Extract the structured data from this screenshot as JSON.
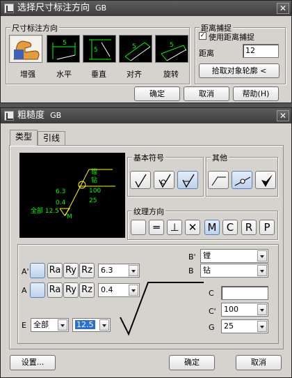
{
  "dialog1": {
    "title": "选择尺寸标注方向",
    "title_suffix": "GB",
    "group_direction": "尺寸标注方向",
    "tiles": [
      {
        "label": "增强",
        "icon": "arm-flex-icon",
        "dim": ""
      },
      {
        "label": "水平",
        "icon": "horizontal-dimension-icon",
        "dim": "5"
      },
      {
        "label": "垂直",
        "icon": "vertical-dimension-icon",
        "dim": "5"
      },
      {
        "label": "对齐",
        "icon": "aligned-dimension-icon",
        "dim": "5"
      },
      {
        "label": "旋转",
        "icon": "rotated-dimension-icon",
        "dim": "5"
      }
    ],
    "group_snap": "距离捕捉",
    "snap_checkbox_label": "使用距离捕捉",
    "snap_checked": true,
    "distance_label": "距离",
    "distance_value": "12",
    "pick_button": "拾取对象轮廓 <",
    "ok": "确定",
    "cancel": "取消",
    "help": "帮助(H)"
  },
  "dialog2": {
    "title": "粗糙度",
    "title_suffix": "GB",
    "tabs": [
      "类型",
      "引线"
    ],
    "preview": {
      "top_labels": [
        "镗",
        "钻"
      ],
      "values": [
        "6.3",
        "0.4",
        "100",
        "25"
      ],
      "all_text": "全部 12.5",
      "m_text": "M",
      "color": "#00ff00"
    },
    "group_basic": "基本符号",
    "group_other": "其他",
    "group_texture": "纹理方向",
    "texture_buttons": [
      "",
      "═",
      "⊥",
      "✕",
      "M",
      "C",
      "R",
      "P"
    ],
    "row_a_prime": {
      "label": "A'",
      "buttons": [
        "Ra",
        "Ry",
        "Rz"
      ],
      "value": "6.3"
    },
    "row_a": {
      "label": "A",
      "buttons": [
        "Ra",
        "Ry",
        "Rz"
      ],
      "value": "0.4"
    },
    "row_e": {
      "label": "E",
      "scope": "全部",
      "value": "12.5"
    },
    "b_prime": {
      "label": "B'",
      "value": "镗"
    },
    "b": {
      "label": "B",
      "value": "钻"
    },
    "c": {
      "label": "C",
      "value": ""
    },
    "c_prime": {
      "label": "C'",
      "value": "100"
    },
    "g": {
      "label": "G",
      "value": "25"
    },
    "settings": "设置...",
    "ok": "确定",
    "cancel": "取消"
  }
}
